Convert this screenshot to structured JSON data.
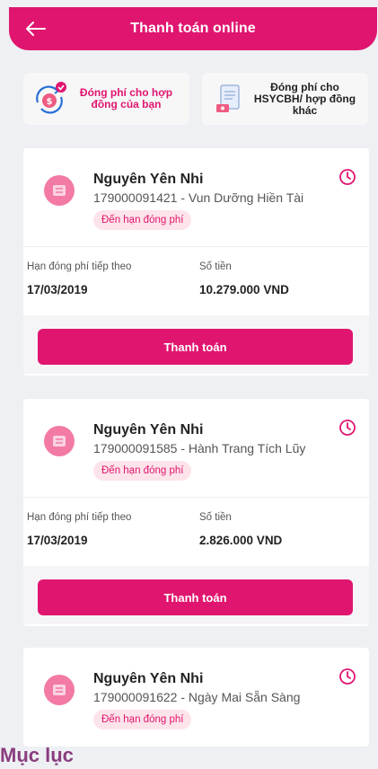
{
  "header": {
    "title": "Thanh toán online"
  },
  "quick_actions": [
    {
      "label": "Đóng phí cho hợp đồng của bạn"
    },
    {
      "label": "Đóng phí cho HSYCBH/ hợp đồng khác"
    }
  ],
  "cards": [
    {
      "holder": "Nguyên Yên Nhi",
      "policy": "179000091421 - Vun Dưỡng Hiền Tài",
      "badge": "Đến hạn đóng phí",
      "next_due_label": "Hạn đóng phí tiếp theo",
      "next_due_value": "17/03/2019",
      "amount_label": "Số tiền",
      "amount_value": "10.279.000 VND",
      "pay_label": "Thanh toán"
    },
    {
      "holder": "Nguyên Yên Nhi",
      "policy": "179000091585 - Hành Trang Tích Lũy",
      "badge": "Đến hạn đóng phí",
      "next_due_label": "Hạn đóng phí tiếp theo",
      "next_due_value": "17/03/2019",
      "amount_label": "Số tiền",
      "amount_value": "2.826.000 VND",
      "pay_label": "Thanh toán"
    },
    {
      "holder": "Nguyên Yên Nhi",
      "policy": "179000091622 - Ngày Mai Sẵn Sàng",
      "badge": "Đến hạn đóng phí"
    }
  ],
  "footer": {
    "toc_label": "Mục lục"
  },
  "colors": {
    "accent": "#e0156f",
    "badge_bg": "#fde4ea",
    "toc": "#8a3d7f"
  },
  "icons": [
    "back-arrow-icon",
    "payment-refresh-icon",
    "document-money-icon",
    "avatar-icon",
    "clock-icon"
  ]
}
